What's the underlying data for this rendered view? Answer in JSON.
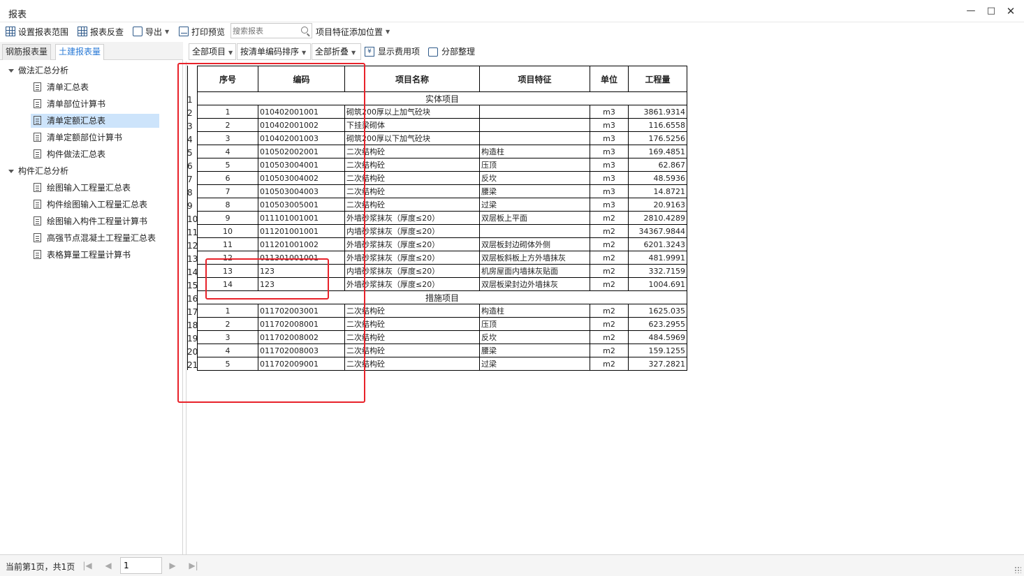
{
  "window": {
    "title": "报表"
  },
  "toolbar": {
    "set_range": "设置报表范围",
    "reverse_check": "报表反查",
    "export": "导出",
    "print_preview": "打印预览",
    "search_placeholder": "搜索报表",
    "feature_position": "项目特征添加位置"
  },
  "left_tabs": {
    "rebar": "钢筋报表量",
    "civil": "土建报表量"
  },
  "tree": {
    "group1": "做法汇总分析",
    "group1_items": [
      "清单汇总表",
      "清单部位计算书",
      "清单定额汇总表",
      "清单定额部位计算书",
      "构件做法汇总表"
    ],
    "group2": "构件汇总分析",
    "group2_items": [
      "绘图输入工程量汇总表",
      "构件绘图输入工程量汇总表",
      "绘图输入构件工程量计算书",
      "高强节点混凝土工程量汇总表",
      "表格算量工程量计算书"
    ]
  },
  "report_toolbar": {
    "all_items": "全部项目",
    "sort_by_code": "按清单编码排序",
    "collapse_all": "全部折叠",
    "show_fees": "显示费用项",
    "section_organize": "分部整理"
  },
  "report": {
    "headers": [
      "序号",
      "编码",
      "项目名称",
      "项目特征",
      "单位",
      "工程量"
    ],
    "row_numbers": [
      "1",
      "2",
      "3",
      "4",
      "5",
      "6",
      "7",
      "8",
      "9",
      "10",
      "11",
      "12",
      "13",
      "14",
      "15",
      "16",
      "17",
      "18",
      "19",
      "20",
      "21"
    ],
    "section1": "实体项目",
    "rows1": [
      [
        "1",
        "010402001001",
        "砌筑200厚以上加气砼块",
        "",
        "m3",
        "3861.9314"
      ],
      [
        "2",
        "010402001002",
        "下挂梁砌体",
        "",
        "m3",
        "116.6558"
      ],
      [
        "3",
        "010402001003",
        "砌筑200厚以下加气砼块",
        "",
        "m3",
        "176.5256"
      ],
      [
        "4",
        "010502002001",
        "二次结构砼",
        "构造柱",
        "m3",
        "169.4851"
      ],
      [
        "5",
        "010503004001",
        "二次结构砼",
        "压顶",
        "m3",
        "62.867"
      ],
      [
        "6",
        "010503004002",
        "二次结构砼",
        "反坎",
        "m3",
        "48.5936"
      ],
      [
        "7",
        "010503004003",
        "二次结构砼",
        "腰梁",
        "m3",
        "14.8721"
      ],
      [
        "8",
        "010503005001",
        "二次结构砼",
        "过梁",
        "m3",
        "20.9163"
      ],
      [
        "9",
        "011101001001",
        "外墙砂浆抹灰（厚度≤20）",
        "双层板上平面",
        "m2",
        "2810.4289"
      ],
      [
        "10",
        "011201001001",
        "内墙砂浆抹灰（厚度≤20）",
        "",
        "m2",
        "34367.9844"
      ],
      [
        "11",
        "011201001002",
        "外墙砂浆抹灰（厚度≤20）",
        "双层板封边砌体外侧",
        "m2",
        "6201.3243"
      ],
      [
        "12",
        "011301001001",
        "外墙砂浆抹灰（厚度≤20）",
        "双层板斜板上方外墙抹灰",
        "m2",
        "481.9991"
      ],
      [
        "13",
        "123",
        "内墙砂浆抹灰（厚度≤20）",
        "机房屋面内墙抹灰贴面",
        "m2",
        "332.7159"
      ],
      [
        "14",
        "123",
        "外墙砂浆抹灰（厚度≤20）",
        "双层板梁封边外墙抹灰",
        "m2",
        "1004.691"
      ]
    ],
    "section2": "措施项目",
    "rows2": [
      [
        "1",
        "011702003001",
        "二次结构砼",
        "构造柱",
        "m2",
        "1625.035"
      ],
      [
        "2",
        "011702008001",
        "二次结构砼",
        "压顶",
        "m2",
        "623.2955"
      ],
      [
        "3",
        "011702008002",
        "二次结构砼",
        "反坎",
        "m2",
        "484.5969"
      ],
      [
        "4",
        "011702008003",
        "二次结构砼",
        "腰梁",
        "m2",
        "159.1255"
      ],
      [
        "5",
        "011702009001",
        "二次结构砼",
        "过梁",
        "m2",
        "327.2821"
      ]
    ]
  },
  "status": {
    "page_info": "当前第1页，共1页",
    "current_page": "1"
  },
  "colors": {
    "accent": "#2a7ad6",
    "selection": "#cde4fb",
    "annotation": "#e8222a"
  },
  "icons": [
    "minimize-icon",
    "maximize-icon",
    "close-icon",
    "grid-icon",
    "export-icon",
    "print-icon",
    "search-icon",
    "yen-icon",
    "organize-icon",
    "document-icon"
  ]
}
